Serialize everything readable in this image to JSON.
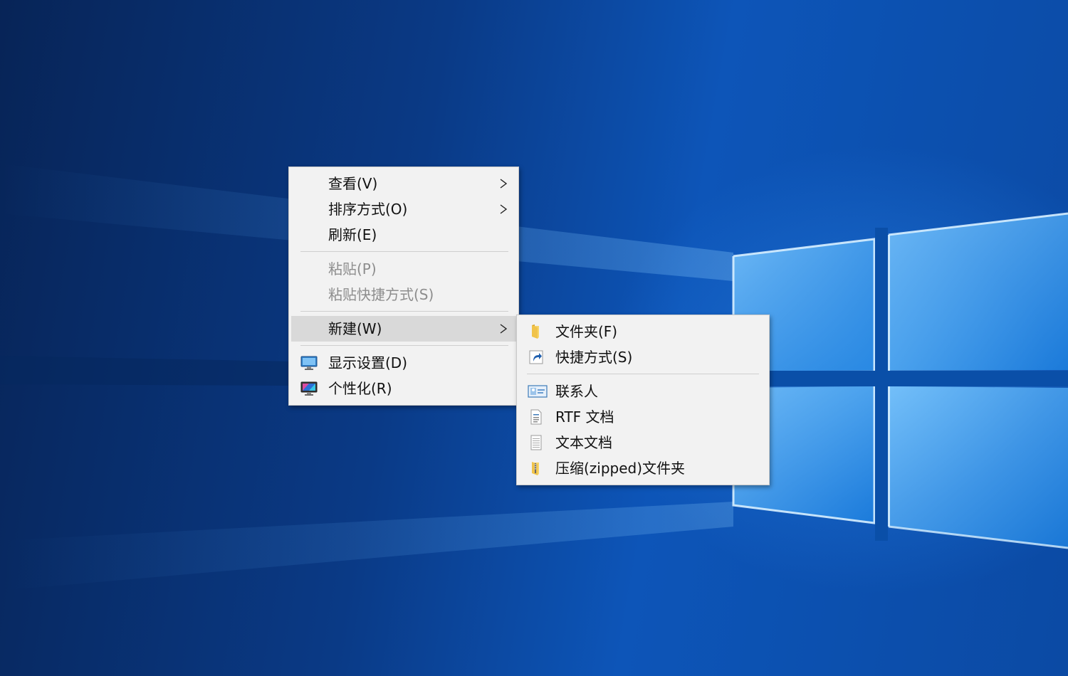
{
  "context_menu": {
    "items": [
      {
        "label": "查看(V)"
      },
      {
        "label": "排序方式(O)"
      },
      {
        "label": "刷新(E)"
      },
      {
        "label": "粘贴(P)"
      },
      {
        "label": "粘贴快捷方式(S)"
      },
      {
        "label": "新建(W)"
      },
      {
        "label": "显示设置(D)"
      },
      {
        "label": "个性化(R)"
      }
    ]
  },
  "new_submenu": {
    "items": [
      {
        "label": "文件夹(F)"
      },
      {
        "label": "快捷方式(S)"
      },
      {
        "label": "联系人"
      },
      {
        "label": "RTF 文档"
      },
      {
        "label": "文本文档"
      },
      {
        "label": "压缩(zipped)文件夹"
      }
    ]
  },
  "colors": {
    "menu_background": "#f2f2f2",
    "highlight": "#d9d9d9",
    "disabled_text": "#8d8d8d",
    "wallpaper_blue": "#0d55b8"
  }
}
